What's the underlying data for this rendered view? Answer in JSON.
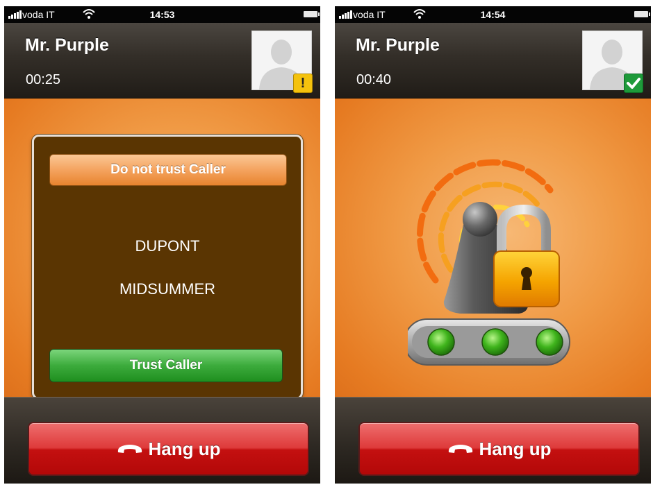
{
  "screens": [
    {
      "status_bar": {
        "carrier": "voda IT",
        "time": "14:53"
      },
      "header": {
        "contact_name": "Mr. Purple",
        "call_timer": "00:25",
        "status_badge": "warning",
        "badge_text": "!"
      },
      "dialog": {
        "distrust_label": "Do not trust Caller",
        "sas_words": [
          "DUPONT",
          "MIDSUMMER"
        ],
        "trust_label": "Trust Caller"
      },
      "footer": {
        "hangup_label": "Hang up"
      }
    },
    {
      "status_bar": {
        "carrier": "voda IT",
        "time": "14:54"
      },
      "header": {
        "contact_name": "Mr. Purple",
        "call_timer": "00:40",
        "status_badge": "verified"
      },
      "secure_indicator": {
        "lights": [
          "green",
          "green",
          "green"
        ]
      },
      "footer": {
        "hangup_label": "Hang up"
      }
    }
  ],
  "colors": {
    "orange_bg": "#f09a45",
    "dialog_bg": "#5a3502",
    "hangup_red": "#c41010",
    "trust_green": "#3cab3c",
    "warning_yellow": "#f4c20d",
    "verified_green": "#1e9a3a"
  }
}
